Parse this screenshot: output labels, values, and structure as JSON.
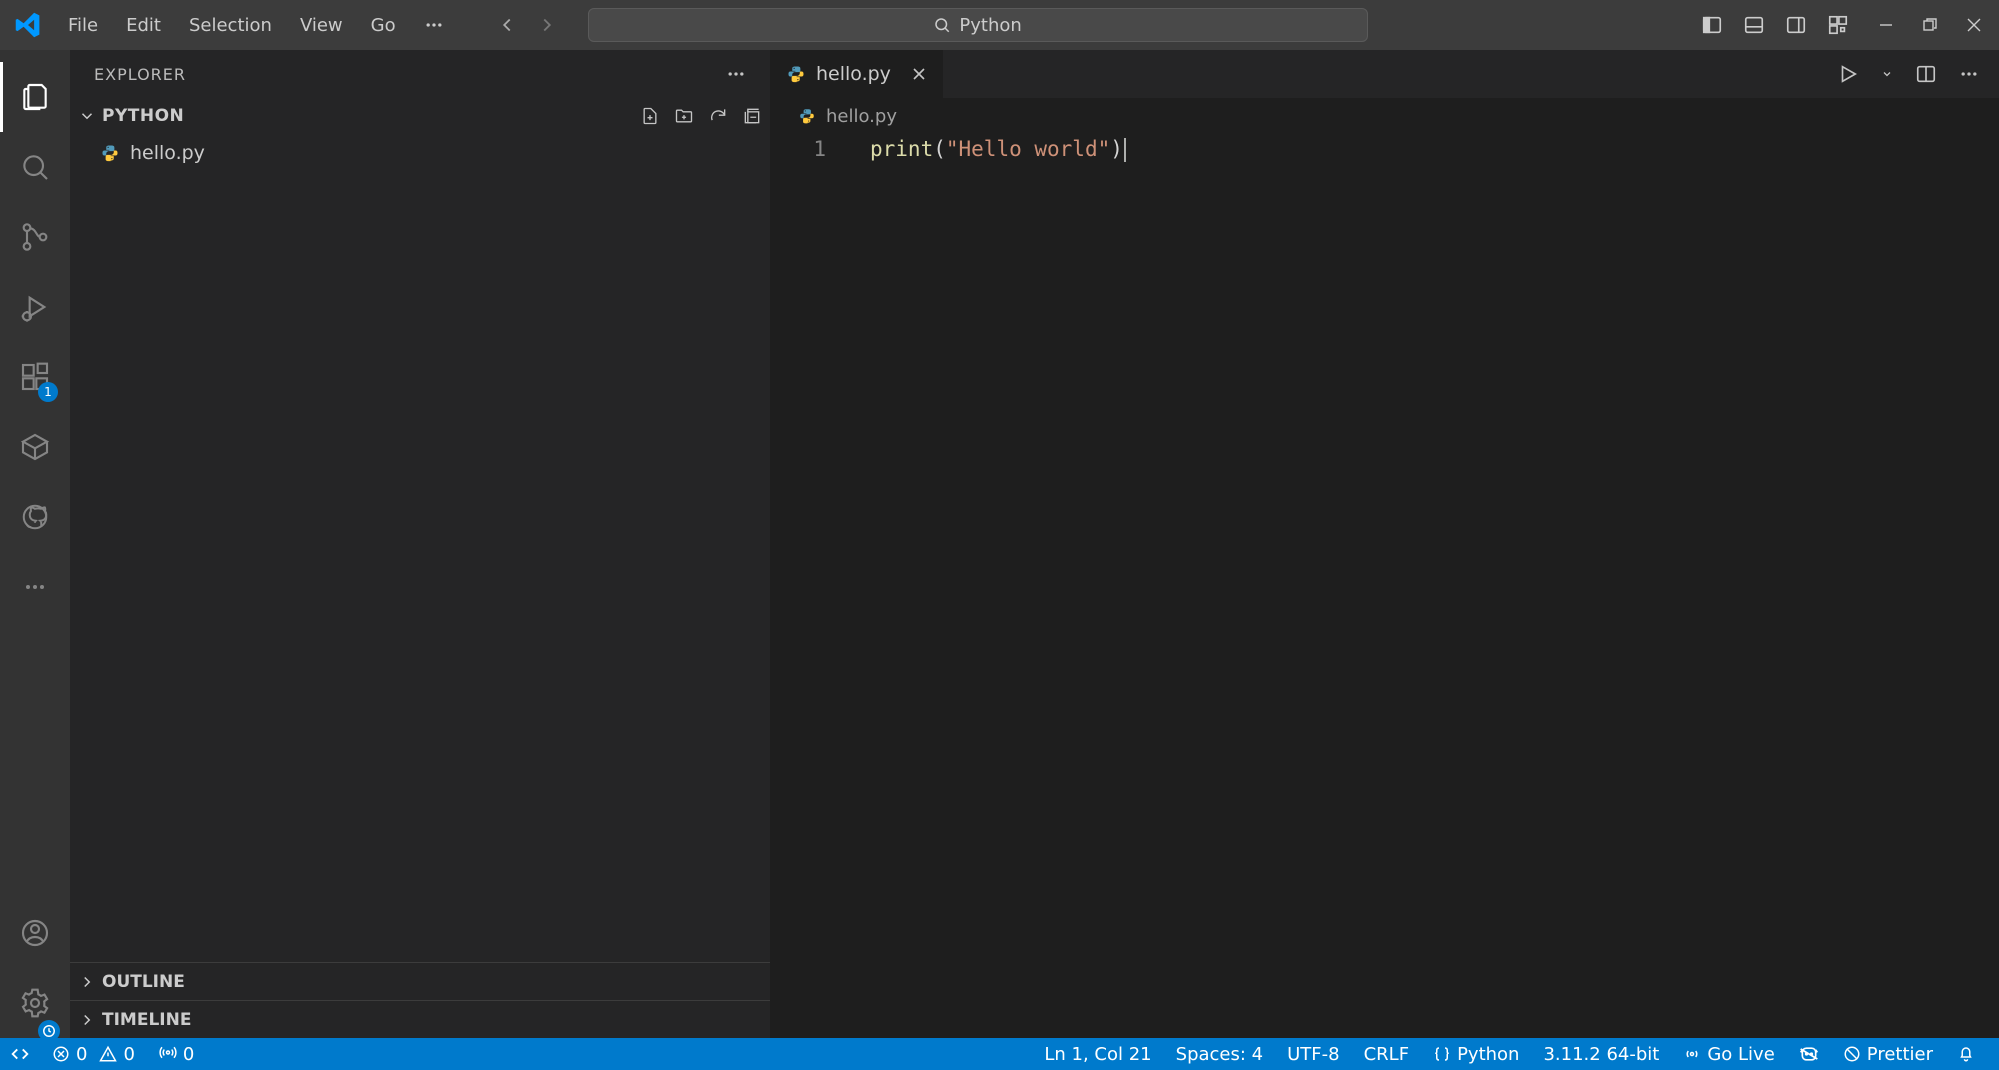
{
  "titlebar": {
    "menu": [
      "File",
      "Edit",
      "Selection",
      "View",
      "Go"
    ],
    "search_placeholder": "Python"
  },
  "activitybar": {
    "extensions_badge": "1"
  },
  "sidebar": {
    "title": "EXPLORER",
    "folder_name": "PYTHON",
    "files": [
      {
        "name": "hello.py",
        "icon": "python-file-icon"
      }
    ],
    "sections": [
      "OUTLINE",
      "TIMELINE"
    ]
  },
  "editor": {
    "tab": {
      "name": "hello.py",
      "icon": "python-file-icon"
    },
    "breadcrumb": "hello.py",
    "lines": [
      {
        "num": "1",
        "tokens": [
          {
            "t": "print",
            "c": "fn"
          },
          {
            "t": "(",
            "c": "pn"
          },
          {
            "t": "\"Hello world\"",
            "c": "str"
          },
          {
            "t": ")",
            "c": "pn"
          }
        ]
      }
    ]
  },
  "statusbar": {
    "errors": "0",
    "warnings": "0",
    "ports": "0",
    "ln_col": "Ln 1, Col 21",
    "spaces": "Spaces: 4",
    "encoding": "UTF-8",
    "eol": "CRLF",
    "language": "Python",
    "interpreter": "3.11.2 64-bit",
    "golive": "Go Live",
    "prettier": "Prettier"
  }
}
